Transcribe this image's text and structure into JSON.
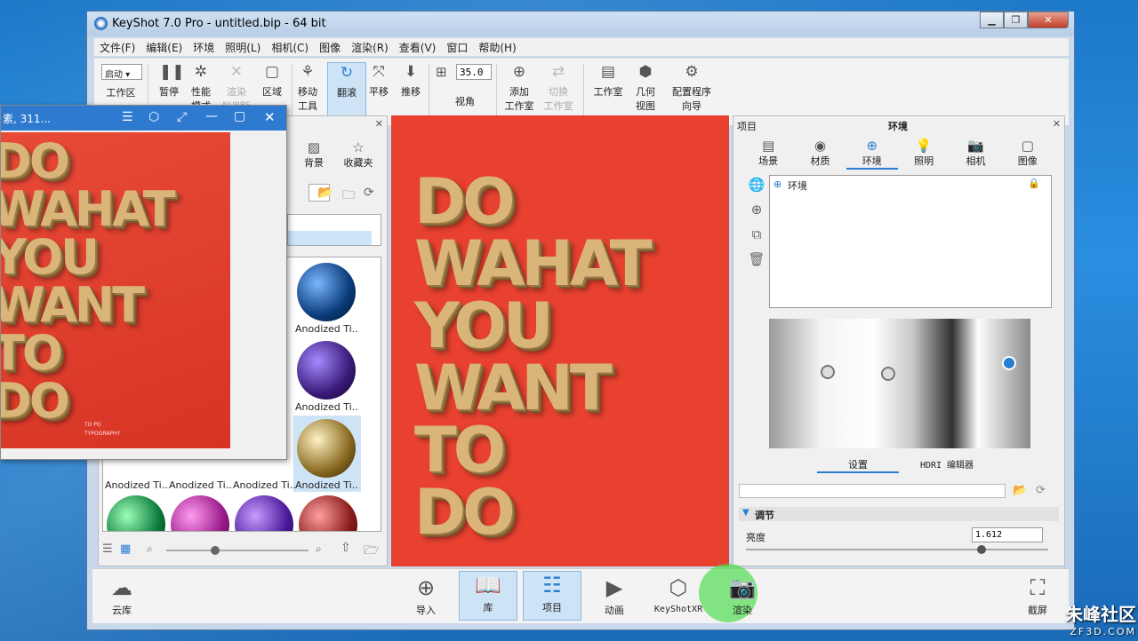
{
  "window": {
    "title": "KeyShot 7.0 Pro  - untitled.bip  - 64 bit"
  },
  "menu": [
    "文件(F)",
    "编辑(E)",
    "环境",
    "照明(L)",
    "相机(C)",
    "图像",
    "渲染(R)",
    "查看(V)",
    "窗口",
    "帮助(H)"
  ],
  "toolbar": {
    "startup_value": "启动",
    "angle_value": "35.0",
    "items": {
      "workspace": "工作区",
      "pause": "暂停",
      "perf1": "性能",
      "perf2": "模式",
      "nurbs1": "渲染",
      "nurbs2": "NURBS",
      "region": "区域",
      "move1": "移动",
      "move2": "工具",
      "tumble": "翻滚",
      "pan": "平移",
      "dolly": "推移",
      "view_angle": "视角",
      "add_studio1": "添加",
      "add_studio2": "工作室",
      "switch_studio1": "切换",
      "switch_studio2": "工作室",
      "studio": "工作室",
      "geometry1": "几何",
      "geometry2": "视图",
      "wizard1": "配置程序",
      "wizard2": "向导"
    }
  },
  "preview": {
    "title": "素, 311...",
    "lines": [
      "DO",
      "WAHAT",
      "YOU",
      "WANT",
      "TO",
      "DO"
    ],
    "small1": "TYPOGRAPHY",
    "small2": "TO  PO"
  },
  "library": {
    "tab_background": "背景",
    "tab_favorites": "收藏夹",
    "materials": [
      "Anodized Ti...",
      "Anodized Ti...",
      "Anodized Ti...",
      "Anodized Ti...",
      "Anodized Ti...",
      "Anodized Ti..."
    ]
  },
  "viewport": {
    "lines": [
      "DO",
      "WAHAT",
      "YOU",
      "WANT",
      "TO",
      "DO"
    ]
  },
  "project": {
    "header_left": "项目",
    "header_title": "环境",
    "tabs": [
      "场景",
      "材质",
      "环境",
      "照明",
      "相机",
      "图像"
    ],
    "env_item": "环境",
    "subtab_settings": "设置",
    "subtab_hdri": "HDRI 编辑器",
    "adjust": "调节",
    "brightness_label": "亮度",
    "brightness_value": "1.612"
  },
  "bottom": {
    "cloud": "云库",
    "import": "导入",
    "library": "库",
    "project": "项目",
    "animation": "动画",
    "xr": "KeyShotXR",
    "render": "渲染",
    "screenshot": "截屏"
  },
  "watermark": {
    "brand": "朱峰社区",
    "url": "ZF3D.COM"
  },
  "colors": {
    "accent": "#2a7ed0",
    "viewport_bg": "#e8412f",
    "gold": "#d9b57a"
  }
}
